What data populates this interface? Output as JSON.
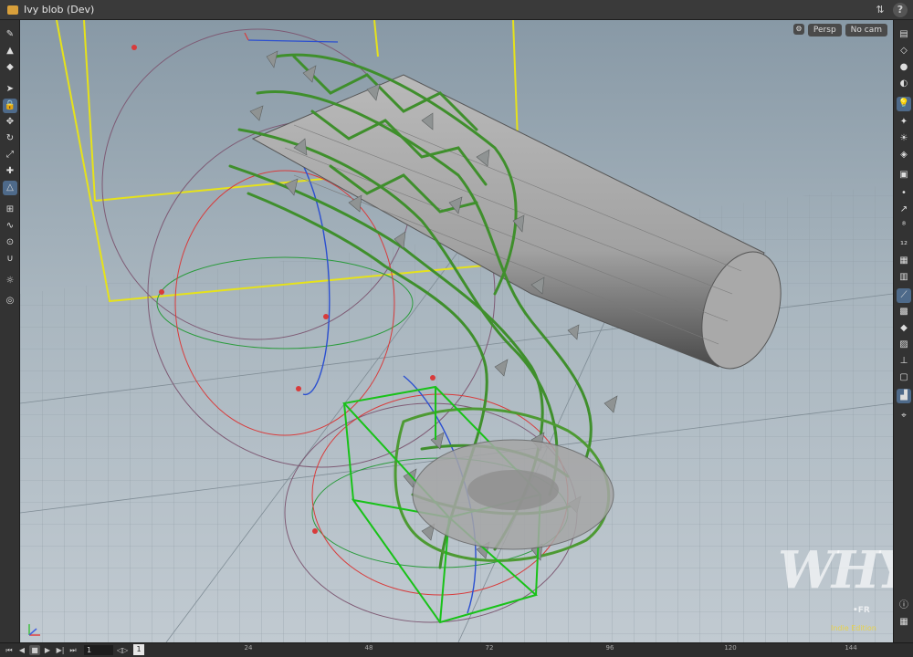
{
  "window": {
    "title": "Ivy blob (Dev)"
  },
  "viewport": {
    "camera_view": "Persp",
    "camera_name": "No cam",
    "watermark": "WHY",
    "watermark_sub": "•FR",
    "edition": "Indie Edition"
  },
  "timeline": {
    "current_frame": "1",
    "marker_frame": "1",
    "ticks": [
      "24",
      "48",
      "72",
      "96",
      "120",
      "144"
    ]
  },
  "colors": {
    "accent": "#4e6a8a",
    "ivy_green": "#3f8f2c",
    "bounding_box_yellow": "#e6e21a",
    "bounding_box_green": "#18c218",
    "edition_yellow": "#e8d24a"
  }
}
